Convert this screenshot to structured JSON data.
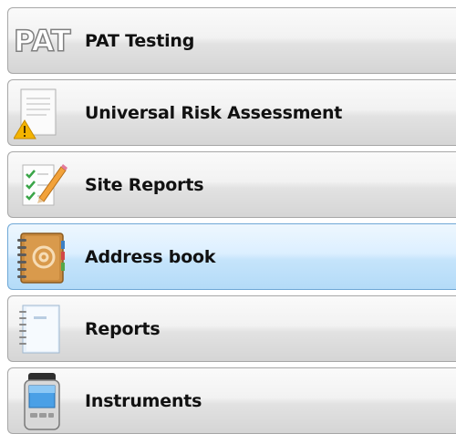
{
  "nav": {
    "items": [
      {
        "label": "PAT Testing",
        "icon": "pat-logo",
        "logo_text": "PAT",
        "selected": false
      },
      {
        "label": "Universal Risk Assessment",
        "icon": "risk-document-warning-icon",
        "selected": false
      },
      {
        "label": "Site Reports",
        "icon": "checklist-pencil-icon",
        "selected": false
      },
      {
        "label": "Address book",
        "icon": "address-book-icon",
        "selected": true
      },
      {
        "label": "Reports",
        "icon": "notebook-icon",
        "selected": false
      },
      {
        "label": "Instruments",
        "icon": "handheld-instrument-icon",
        "selected": false
      }
    ]
  },
  "colors": {
    "item_gradient_top": "#fafafa",
    "item_gradient_bottom": "#d5d5d5",
    "selected_gradient_top": "#eef7fe",
    "selected_gradient_bottom": "#b4dbf8",
    "border": "#a7a7a7",
    "selected_border": "#6fa8d6"
  }
}
